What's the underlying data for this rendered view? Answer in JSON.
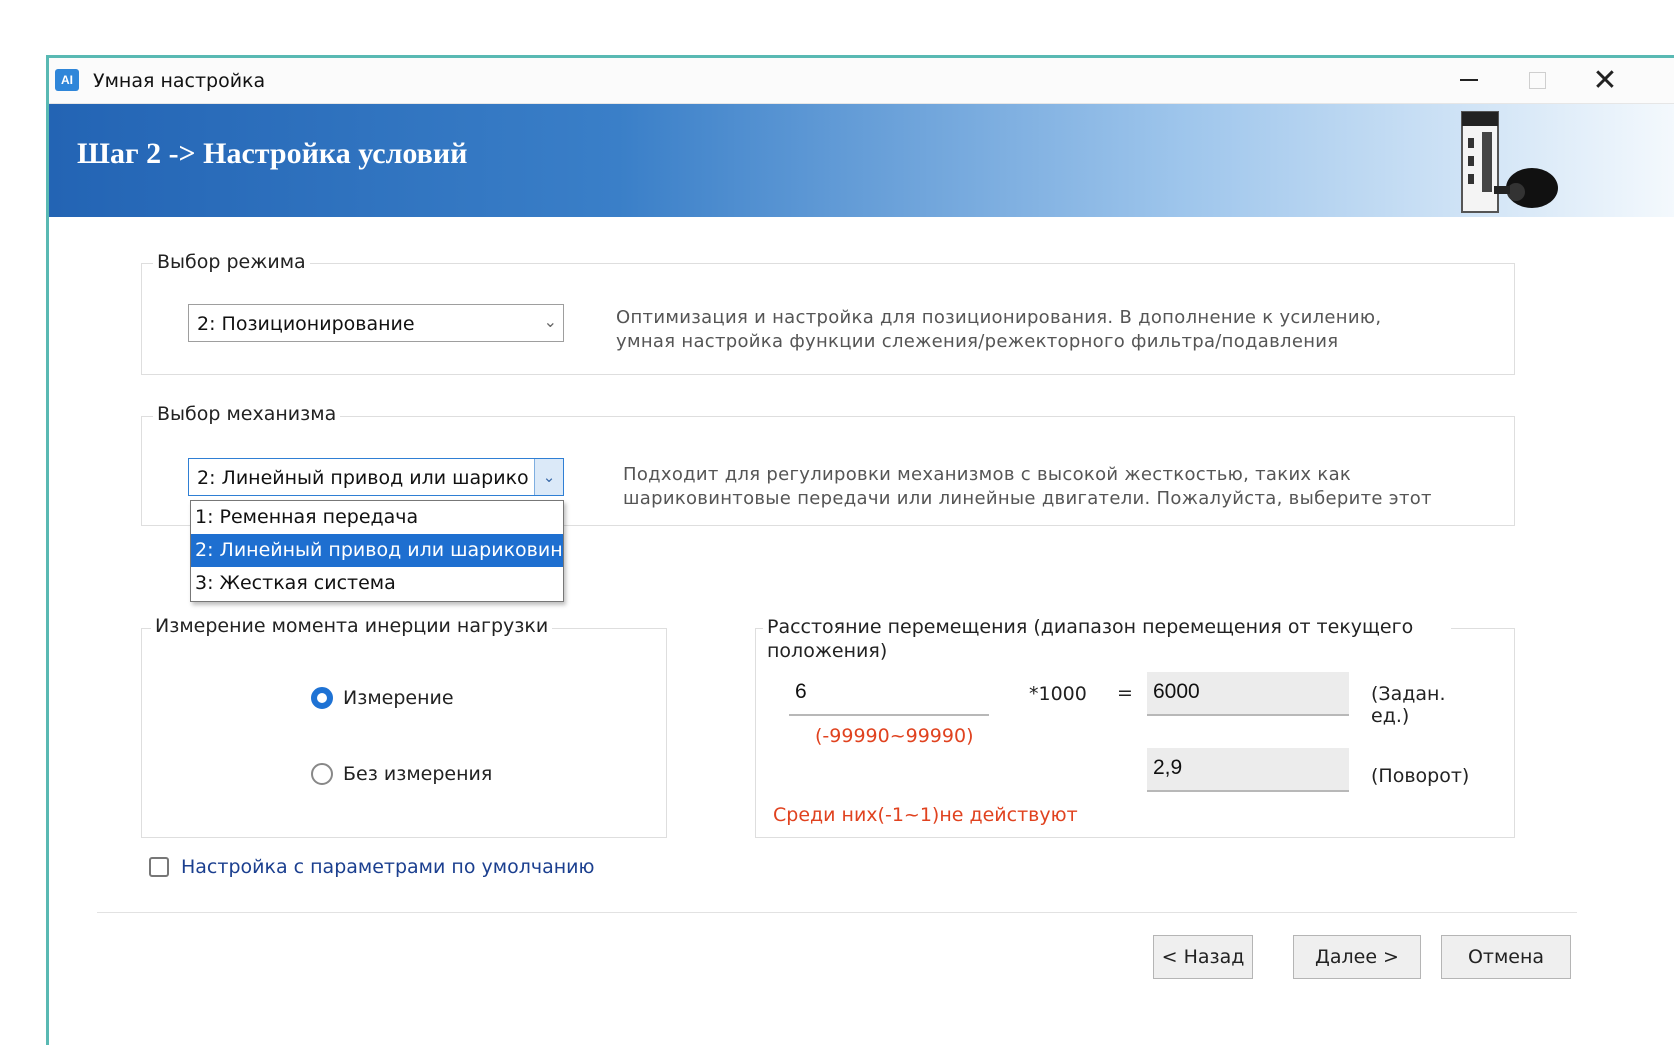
{
  "window": {
    "app_icon_text": "AI",
    "title": "Умная настройка",
    "close_glyph": "✕"
  },
  "banner": {
    "title": "Шаг 2 -> Настройка условий",
    "image_icon": "servo-drive-icon"
  },
  "mode": {
    "legend": "Выбор режима",
    "selected": "2: Позиционирование",
    "description_line1": "Оптимизация и настройка для позиционирования. В дополнение к усилению,",
    "description_line2": "умная настройка функции слежения/режекторного фильтра/подавления"
  },
  "mechanism": {
    "legend": "Выбор механизма",
    "selected": "2: Линейный привод или шарико",
    "description_line1": "Подходит для регулировки механизмов с высокой жесткостью, таких как",
    "description_line2": "шариковинтовые передачи или линейные двигатели. Пожалуйста, выберите этот",
    "options": [
      "1: Ременная передача",
      "2: Линейный привод или шариковин",
      "3: Жесткая система"
    ],
    "selected_index": 1
  },
  "inertia": {
    "legend": "Измерение момента инерции нагрузки",
    "option_measure": "Измерение",
    "option_no_measure": "Без измерения",
    "selected": "Измерение"
  },
  "distance": {
    "legend": "Расстояние перемещения (диапазон перемещения от текущего положения)",
    "input_value": "6",
    "multiplier": "*1000",
    "equals": "=",
    "result_units": "6000",
    "units_label": "(Задан. ед.)",
    "range_hint": "(-99990~99990)",
    "result_rotation": "2,9",
    "rotation_label": "(Поворот)",
    "warning": "Среди них(-1~1)не действуют"
  },
  "default_params": {
    "label": "Настройка с параметрами по умолчанию",
    "checked": false
  },
  "buttons": {
    "back": "< Назад",
    "next": "Далее >",
    "cancel": "Отмена"
  }
}
